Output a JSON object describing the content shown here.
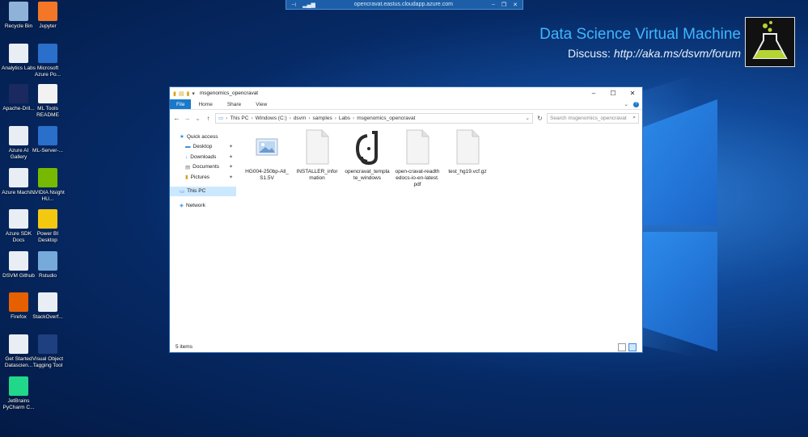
{
  "rdp_bar": {
    "host": "opencravat.eastus.cloudapp.azure.com"
  },
  "branding": {
    "title": "Data Science Virtual Machine",
    "discuss_label": "Discuss:",
    "discuss_url": "http://aka.ms/dsvm/forum"
  },
  "desktop_icons": [
    {
      "label": "Recycle Bin",
      "icon": "recycle-bin-icon",
      "color": "#8fb3d8"
    },
    {
      "label": "Jupyter",
      "icon": "jupyter-icon",
      "color": "#f37726"
    },
    {
      "label": "Analytics Labs",
      "icon": "analytics-labs-icon",
      "color": "#e9eef5"
    },
    {
      "label": "Microsoft Azure Po...",
      "icon": "powershell-icon",
      "color": "#2a6fc9"
    },
    {
      "label": "Apache-Dril...",
      "icon": "apache-drill-icon",
      "color": "#1a2a60"
    },
    {
      "label": "ML Tools README",
      "icon": "readme-doc-icon",
      "color": "#f2f2f2"
    },
    {
      "label": "Azure AI Gallery",
      "icon": "azure-ai-gallery-icon",
      "color": "#e9eef5"
    },
    {
      "label": "ML-Server-...",
      "icon": "ml-server-icon",
      "color": "#2a6fc9"
    },
    {
      "label": "Azure Machi...",
      "icon": "azure-machine-learning-icon",
      "color": "#e9eef5"
    },
    {
      "label": "NVIDIA Nsight HU...",
      "icon": "nvidia-nsight-icon",
      "color": "#76b900"
    },
    {
      "label": "Azure SDK Docs",
      "icon": "azure-sdk-docs-icon",
      "color": "#e9eef5"
    },
    {
      "label": "Power BI Desktop",
      "icon": "power-bi-icon",
      "color": "#f2c811"
    },
    {
      "label": "DSVM Github",
      "icon": "dsvm-github-icon",
      "color": "#e9eef5"
    },
    {
      "label": "Rstudio",
      "icon": "rstudio-icon",
      "color": "#75aadb"
    },
    {
      "label": "Firefox",
      "icon": "firefox-icon",
      "color": "#e66000"
    },
    {
      "label": "StackOverf...",
      "icon": "stackoverflow-icon",
      "color": "#e9eef5"
    },
    {
      "label": "Get Started Datascien...",
      "icon": "get-started-icon",
      "color": "#e9eef5"
    },
    {
      "label": "Visual Object Tagging Tool",
      "icon": "vott-icon",
      "color": "#1e3f80"
    },
    {
      "label": "JetBrains PyCharm C...",
      "icon": "pycharm-icon",
      "color": "#21d789"
    }
  ],
  "explorer": {
    "title": "msgenomics_opencravat",
    "ribbon_tabs": [
      "File",
      "Home",
      "Share",
      "View"
    ],
    "address": [
      "This PC",
      "Windows (C:)",
      "dsvm",
      "samples",
      "Labs",
      "msgenomics_opencravat"
    ],
    "search_placeholder": "Search msgenomics_opencravat",
    "nav": {
      "quick_access": "Quick access",
      "items": [
        "Desktop",
        "Downloads",
        "Documents",
        "Pictures"
      ],
      "this_pc": "This PC",
      "network": "Network"
    },
    "files": [
      {
        "name": "HG004-250bp-All_S1.5V",
        "icon": "image-file-icon"
      },
      {
        "name": "INSTALLER_information",
        "icon": "blank-file-icon"
      },
      {
        "name": "opencravat_template_windows",
        "icon": "opencravat-logo-icon"
      },
      {
        "name": "open-cravat-readthedocs-io-en-latest.pdf",
        "icon": "pdf-file-icon"
      },
      {
        "name": "test_hg19.vcf.gz",
        "icon": "blank-file-icon"
      }
    ],
    "status": "5 items"
  }
}
